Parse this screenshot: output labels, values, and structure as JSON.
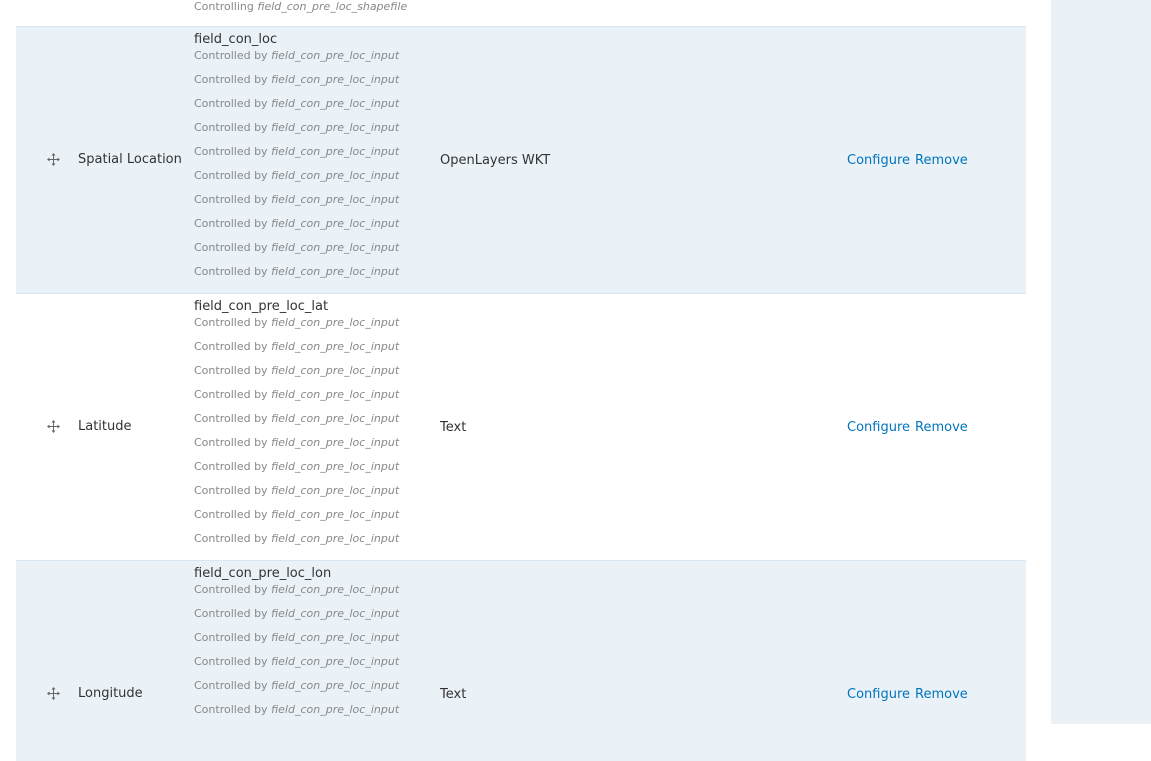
{
  "top_row": {
    "dependency_prefix": "Controlling",
    "dependency_field": "field_con_pre_loc_shapefile"
  },
  "rows": [
    {
      "label": "Spatial Location",
      "field_name": "field_con_loc",
      "widget": "OpenLayers WKT",
      "dependency_prefix": "Controlled by",
      "dependency_field": "field_con_pre_loc_input",
      "configure": "Configure",
      "remove": "Remove",
      "drag_icon": "drag-handle-icon"
    },
    {
      "label": "Latitude",
      "field_name": "field_con_pre_loc_lat",
      "widget": "Text",
      "dependency_prefix": "Controlled by",
      "dependency_field": "field_con_pre_loc_input",
      "configure": "Configure",
      "remove": "Remove",
      "drag_icon": "drag-handle-icon"
    },
    {
      "label": "Longitude",
      "field_name": "field_con_pre_loc_lon",
      "widget": "Text",
      "dependency_prefix": "Controlled by",
      "dependency_field": "field_con_pre_loc_input",
      "configure": "Configure",
      "remove": "Remove",
      "drag_icon": "drag-handle-icon"
    }
  ],
  "colors": {
    "row_alt_bg": "#eaf2f8",
    "link": "#0074bd",
    "muted_text": "#888888",
    "border": "#d6e6f2"
  }
}
